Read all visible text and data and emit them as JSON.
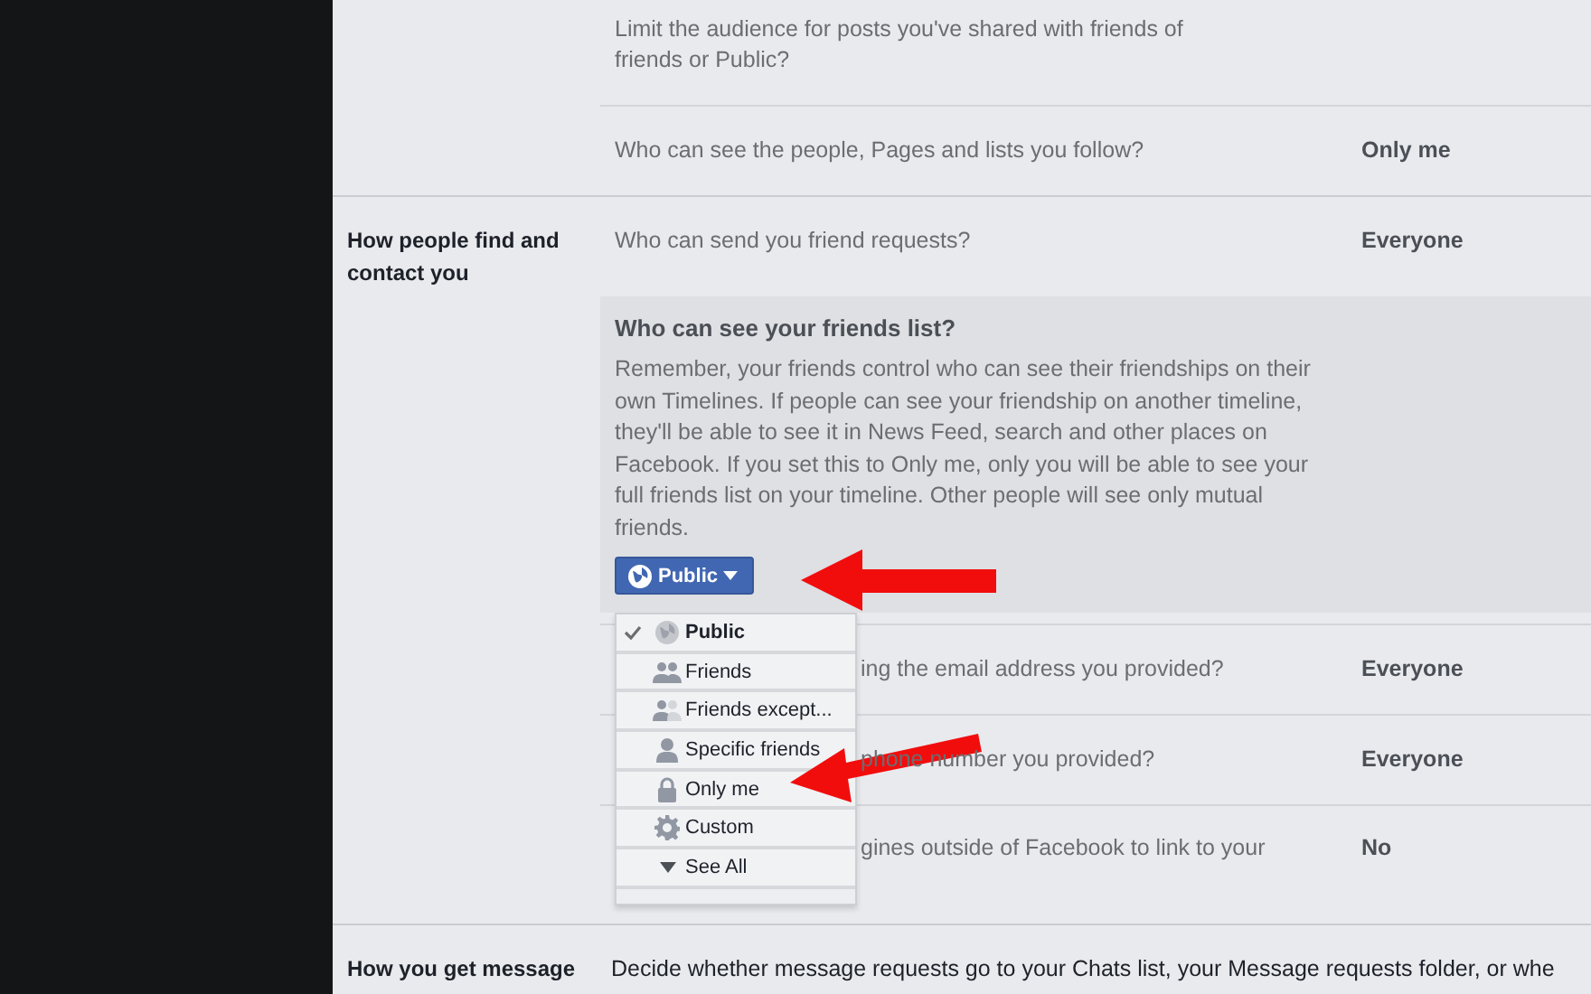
{
  "sections": [
    {
      "rows": [
        {
          "kind": "plain",
          "question": "Limit the audience for posts you've shared with friends of friends or Public?"
        },
        {
          "kind": "plain",
          "question": "Who can see the people, Pages and lists you follow?",
          "value": "Only me"
        }
      ]
    },
    {
      "label": "How people find and contact you",
      "rows": [
        {
          "kind": "plain",
          "question": "Who can send you friend requests?",
          "value": "Everyone"
        },
        {
          "kind": "expanded",
          "title": "Who can see your friends list?",
          "body": "Remember, your friends control who can see their friendships on their own Timelines. If people can see your friendship on another timeline, they'll be able to see it in News Feed, search and other places on Facebook. If you set this to Only me, only you will be able to see your full friends list on your timeline. Other people will see only mutual friends.",
          "audience": "Public",
          "menu": [
            {
              "kind": "globe",
              "label": "Public",
              "selected": true
            },
            {
              "kind": "friends",
              "label": "Friends",
              "selected": false
            },
            {
              "kind": "friends-except",
              "label": "Friends except...",
              "selected": false
            },
            {
              "kind": "person",
              "label": "Specific friends",
              "selected": false
            },
            {
              "kind": "lock",
              "label": "Only me",
              "selected": false
            },
            {
              "kind": "gear",
              "label": "Custom",
              "selected": false
            },
            {
              "kind": "more",
              "label": "See All",
              "selected": false
            }
          ]
        },
        {
          "kind": "covered",
          "question": "ing the email address you provided?",
          "value": "Everyone"
        },
        {
          "kind": "covered",
          "question": "phone number you provided?",
          "value": "Everyone"
        },
        {
          "kind": "covered",
          "question": "gines outside of Facebook to link to your",
          "value": "No"
        }
      ]
    },
    {
      "label": "How you get message",
      "rows": [
        {
          "kind": "lead",
          "question": "Decide whether message requests go to your Chats list, your Message requests folder, or whe"
        }
      ]
    }
  ]
}
